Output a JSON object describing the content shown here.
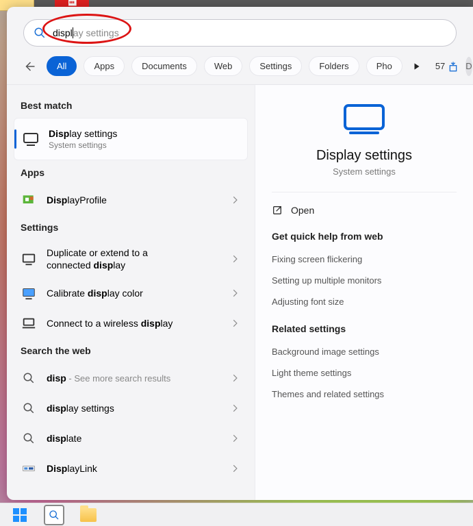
{
  "search": {
    "typed": "displ",
    "ghost": "ay settings"
  },
  "tabs": {
    "all": "All",
    "apps": "Apps",
    "documents": "Documents",
    "web": "Web",
    "settings": "Settings",
    "folders": "Folders",
    "photos": "Pho"
  },
  "points": {
    "value": "57"
  },
  "avatar": {
    "initial": "D"
  },
  "left": {
    "best_match_label": "Best match",
    "best_match": {
      "title_bold": "Disp",
      "title_rest": "lay settings",
      "sub": "System settings"
    },
    "apps_label": "Apps",
    "apps": [
      {
        "pre": "",
        "bold": "Disp",
        "post": "layProfile"
      }
    ],
    "settings_label": "Settings",
    "settings": [
      {
        "line1": "Duplicate or extend to a",
        "line2_pre": "connected ",
        "line2_bold": "disp",
        "line2_post": "lay"
      },
      {
        "pre": "Calibrate ",
        "bold": "disp",
        "post": "lay color"
      },
      {
        "pre": "Connect to a wireless ",
        "bold": "disp",
        "post": "lay"
      }
    ],
    "web_label": "Search the web",
    "web": [
      {
        "pre": "",
        "bold": "disp",
        "post": "",
        "hint": " - See more search results"
      },
      {
        "pre": "",
        "bold": "disp",
        "post": "lay settings",
        "hint": ""
      },
      {
        "pre": "",
        "bold": "disp",
        "post": "late",
        "hint": ""
      },
      {
        "pre": "",
        "bold": "Disp",
        "post": "layLink",
        "hint": ""
      }
    ]
  },
  "right": {
    "title": "Display settings",
    "sub": "System settings",
    "open": "Open",
    "quickhelp_label": "Get quick help from web",
    "quickhelp": [
      "Fixing screen flickering",
      "Setting up multiple monitors",
      "Adjusting font size"
    ],
    "related_label": "Related settings",
    "related": [
      "Background image settings",
      "Light theme settings",
      "Themes and related settings"
    ]
  }
}
